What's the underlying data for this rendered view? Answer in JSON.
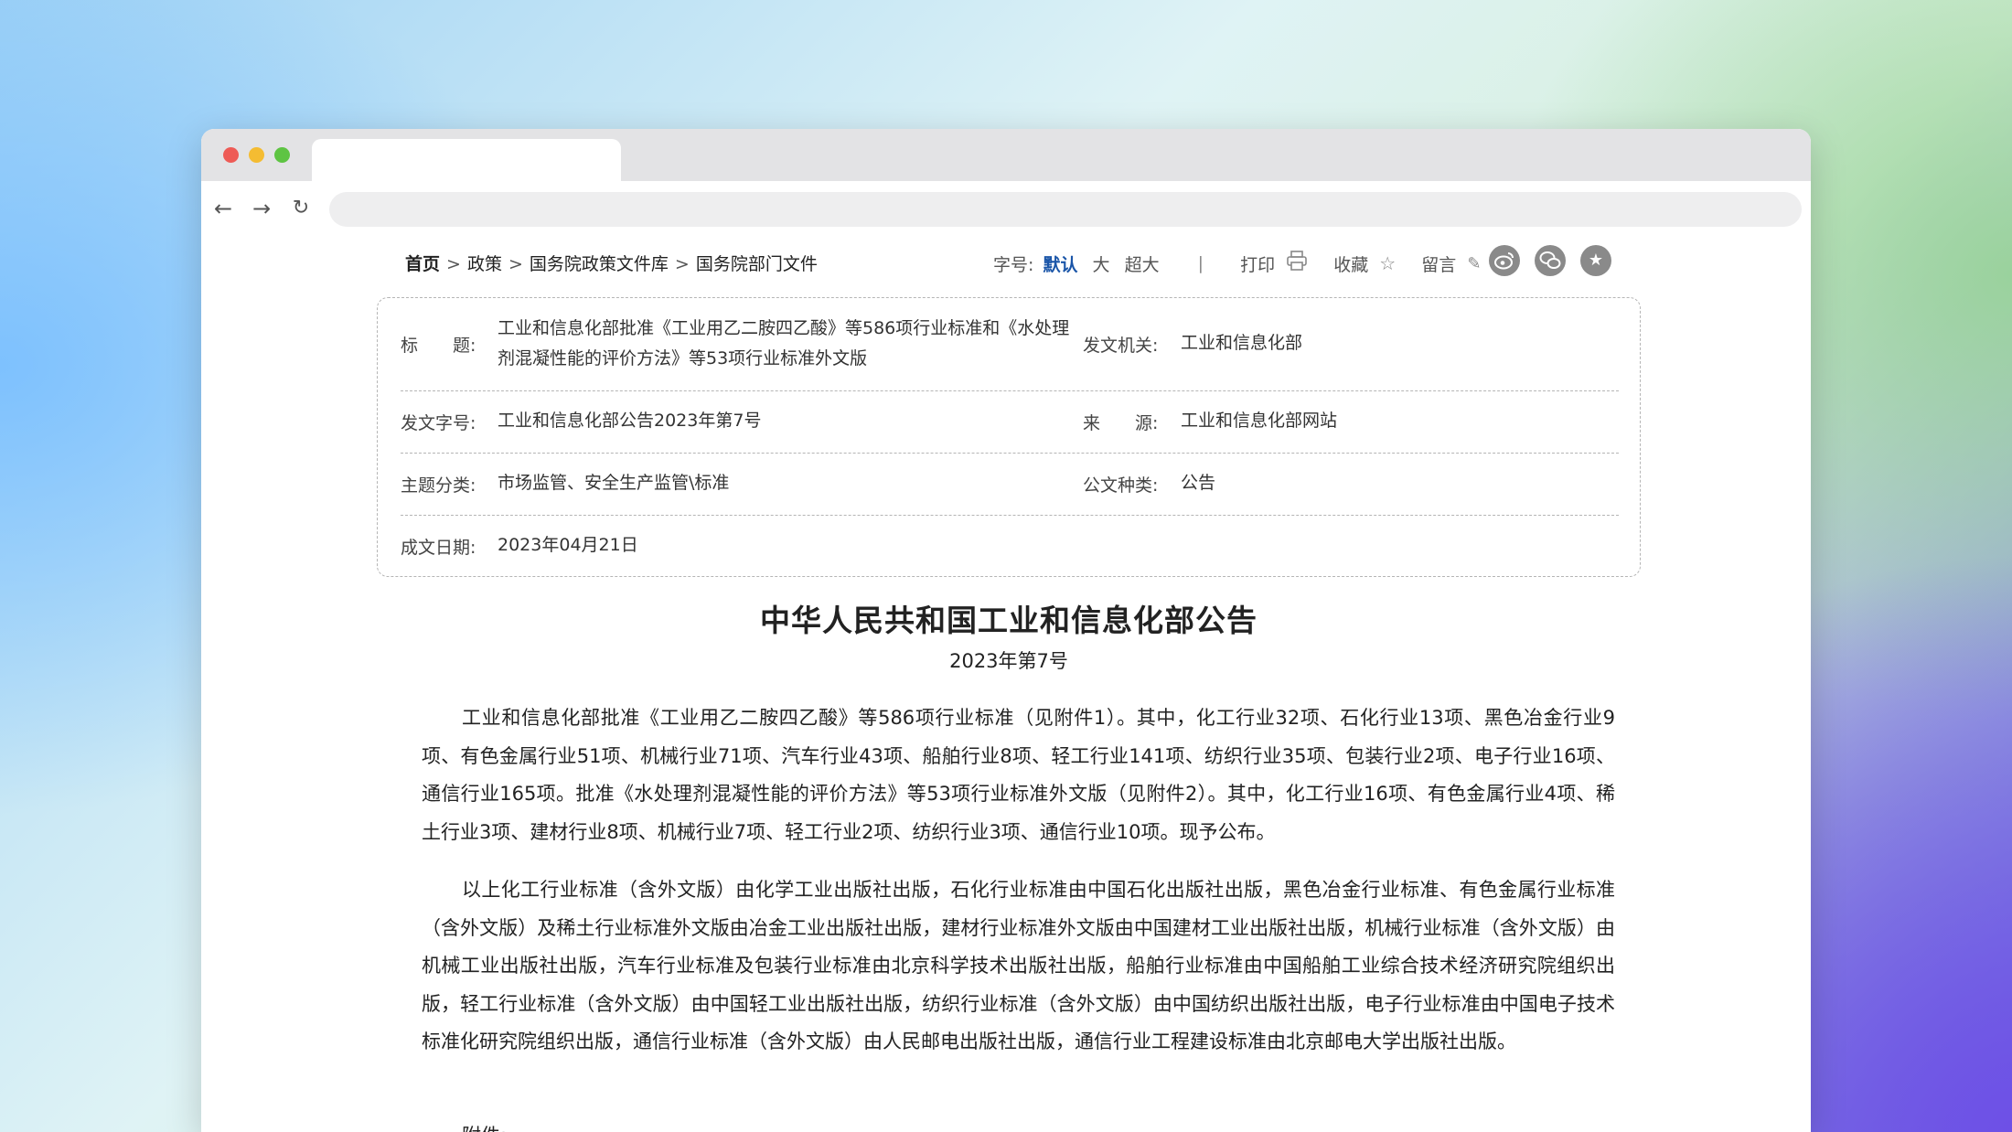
{
  "breadcrumb": {
    "home": "首页",
    "items": [
      "政策",
      "国务院政策文件库",
      "国务院部门文件"
    ],
    "separator": ">"
  },
  "toolbar": {
    "font_size_label": "字号:",
    "font_sizes": [
      "默认",
      "大",
      "超大"
    ],
    "divider": "|",
    "print_label": "打印",
    "favorite_label": "收藏",
    "comment_label": "留言",
    "social_icons": [
      "weibo-icon",
      "wechat-icon",
      "star-share-icon"
    ]
  },
  "info": {
    "title_label": "标　　题:",
    "title_value": "工业和信息化部批准《工业用乙二胺四乙酸》等586项行业标准和《水处理剂混凝性能的评价方法》等53项行业标准外文版",
    "issuer_label": "发文机关:",
    "issuer_value": "工业和信息化部",
    "doc_no_label": "发文字号:",
    "doc_no_value": "工业和信息化部公告2023年第7号",
    "source_label": "来　　源:",
    "source_value": "工业和信息化部网站",
    "category_label": "主题分类:",
    "category_value": "市场监管、安全生产监管\\标准",
    "doc_type_label": "公文种类:",
    "doc_type_value": "公告",
    "date_label": "成文日期:",
    "date_value": "2023年04月21日"
  },
  "document": {
    "title": "中华人民共和国工业和信息化部公告",
    "number": "2023年第7号",
    "paragraphs": [
      "工业和信息化部批准《工业用乙二胺四乙酸》等586项行业标准（见附件1）。其中，化工行业32项、石化行业13项、黑色冶金行业9项、有色金属行业51项、机械行业71项、汽车行业43项、船舶行业8项、轻工行业141项、纺织行业35项、包装行业2项、电子行业16项、通信行业165项。批准《水处理剂混凝性能的评价方法》等53项行业标准外文版（见附件2）。其中，化工行业16项、有色金属行业4项、稀土行业3项、建材行业8项、机械行业7项、轻工行业2项、纺织行业3项、通信行业10项。现予公布。",
      "以上化工行业标准（含外文版）由化学工业出版社出版，石化行业标准由中国石化出版社出版，黑色冶金行业标准、有色金属行业标准（含外文版）及稀土行业标准外文版由冶金工业出版社出版，建材行业标准外文版由中国建材工业出版社出版，机械行业标准（含外文版）由机械工业出版社出版，汽车行业标准及包装行业标准由北京科学技术出版社出版，船舶行业标准由中国船舶工业综合技术经济研究院组织出版，轻工行业标准（含外文版）由中国轻工业出版社出版，纺织行业标准（含外文版）由中国纺织出版社出版，电子行业标准由中国电子技术标准化研究院组织出版，通信行业标准（含外文版）由人民邮电出版社出版，通信行业工程建设标准由北京邮电大学出版社出版。"
    ],
    "attachment_label": "附件:"
  }
}
